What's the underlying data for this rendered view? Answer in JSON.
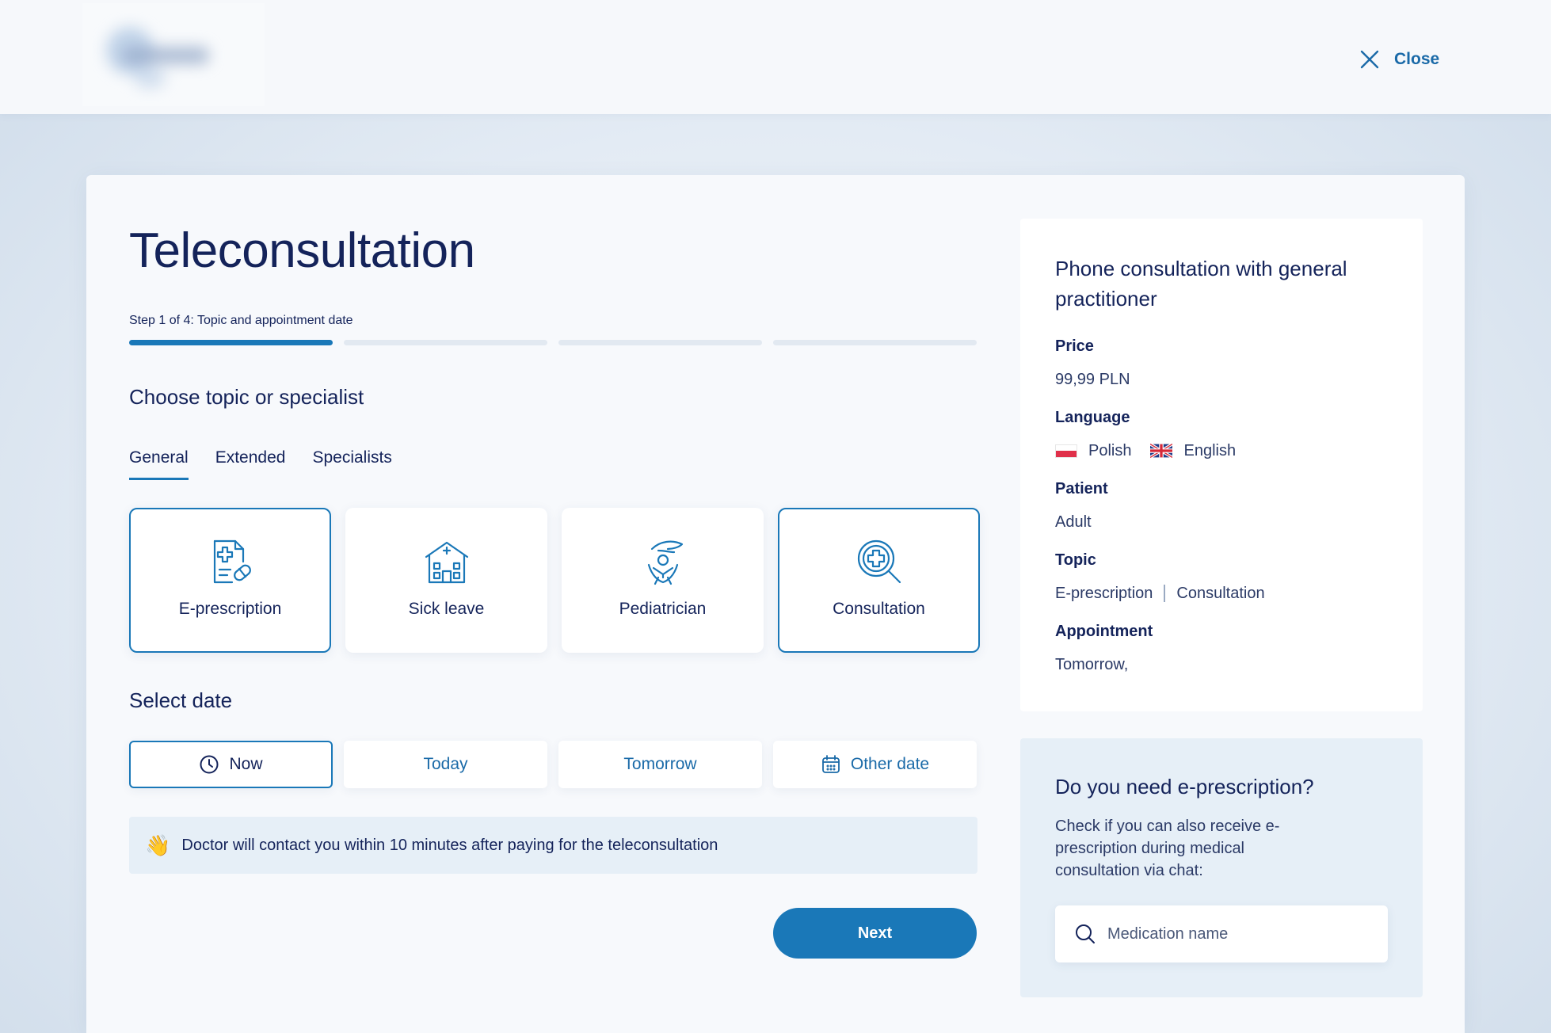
{
  "header": {
    "logo_icon": "blurred-logo",
    "close_label": "Close",
    "close_icon": "close-icon"
  },
  "page": {
    "title": "Teleconsultation",
    "step_label": "Step 1 of 4: Topic and appointment date",
    "progress": {
      "current_step": 1,
      "total_steps": 4
    }
  },
  "topic": {
    "heading": "Choose topic or specialist",
    "tabs": [
      {
        "label": "General",
        "active": true
      },
      {
        "label": "Extended",
        "active": false
      },
      {
        "label": "Specialists",
        "active": false
      }
    ],
    "tiles": [
      {
        "label": "E-prescription",
        "icon": "prescription-icon",
        "selected": true
      },
      {
        "label": "Sick leave",
        "icon": "building-icon",
        "selected": false
      },
      {
        "label": "Pediatrician",
        "icon": "child-care-icon",
        "selected": false
      },
      {
        "label": "Consultation",
        "icon": "medical-search-icon",
        "selected": true
      }
    ]
  },
  "date": {
    "heading": "Select date",
    "options": [
      {
        "label": "Now",
        "icon": "clock-icon",
        "selected": true
      },
      {
        "label": "Today",
        "icon": "",
        "selected": false
      },
      {
        "label": "Tomorrow",
        "icon": "",
        "selected": false
      },
      {
        "label": "Other date",
        "icon": "calendar-icon",
        "selected": false
      }
    ],
    "notice_icon": "waving-hand-icon",
    "notice_emoji": "👋",
    "notice_text": "Doctor will contact you within 10 minutes after paying for the teleconsultation"
  },
  "actions": {
    "next_label": "Next"
  },
  "summary": {
    "title": "Phone consultation with general practitioner",
    "price_label": "Price",
    "price_value": "99,99 PLN",
    "language_label": "Language",
    "languages": [
      "Polish",
      "English"
    ],
    "patient_label": "Patient",
    "patient_value": "Adult",
    "topic_label": "Topic",
    "topics": [
      "E-prescription",
      "Consultation"
    ],
    "appointment_label": "Appointment",
    "appointment_value": "Tomorrow,"
  },
  "eprescription": {
    "title": "Do you need e-prescription?",
    "description": "Check if you can also receive e-prescription during medical consultation via chat:",
    "search_placeholder": "Medication name",
    "search_value": ""
  },
  "colors": {
    "accent": "#1a78b8",
    "text_primary": "#14235a",
    "link": "#1a6aa8",
    "notice_bg": "#e6eff7"
  }
}
